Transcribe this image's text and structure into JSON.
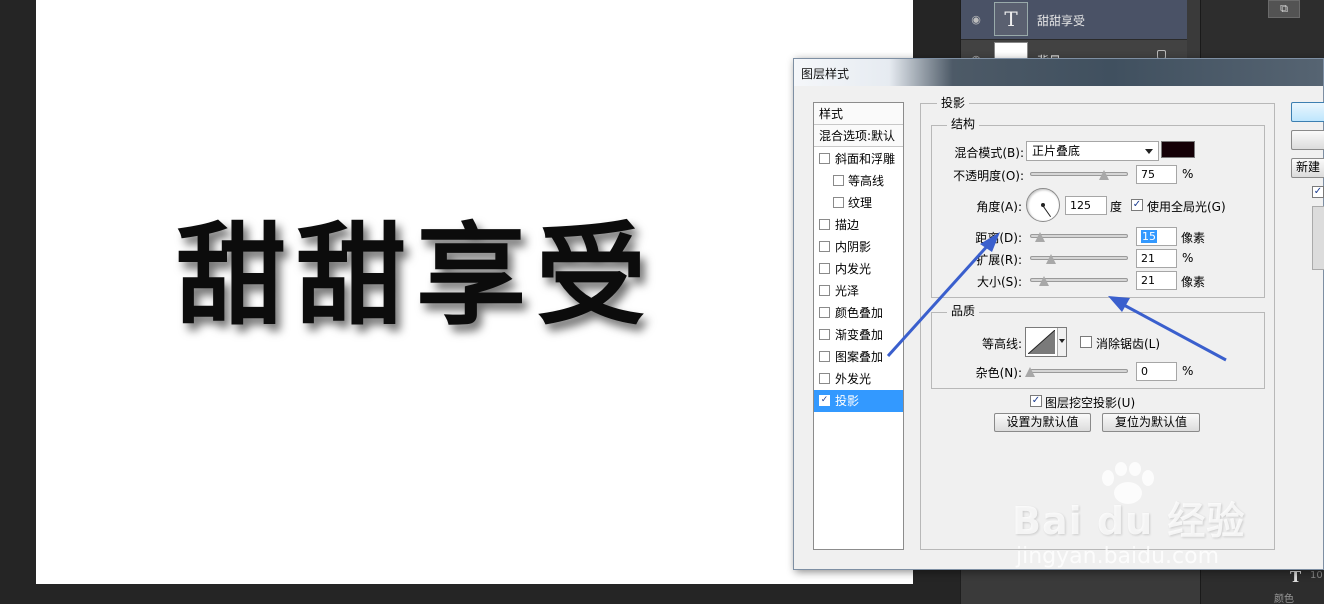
{
  "canvas": {
    "text": "甜甜享受"
  },
  "layers": {
    "text_layer": {
      "name": "甜甜享受",
      "thumb_glyph": "T"
    },
    "bg_layer": {
      "name": "背景"
    }
  },
  "right_panel": {
    "bottom_icon": "T",
    "bottom_num": "10",
    "bottom_label": "颜色"
  },
  "dialog": {
    "title": "图层样式",
    "style_list": {
      "header": "样式",
      "blend_options": "混合选项:默认",
      "items": [
        {
          "label": "斜面和浮雕",
          "checked": false,
          "indent": 0
        },
        {
          "label": "等高线",
          "checked": false,
          "indent": 1
        },
        {
          "label": "纹理",
          "checked": false,
          "indent": 1
        },
        {
          "label": "描边",
          "checked": false,
          "indent": 0
        },
        {
          "label": "内阴影",
          "checked": false,
          "indent": 0
        },
        {
          "label": "内发光",
          "checked": false,
          "indent": 0
        },
        {
          "label": "光泽",
          "checked": false,
          "indent": 0
        },
        {
          "label": "颜色叠加",
          "checked": false,
          "indent": 0
        },
        {
          "label": "渐变叠加",
          "checked": false,
          "indent": 0
        },
        {
          "label": "图案叠加",
          "checked": false,
          "indent": 0
        },
        {
          "label": "外发光",
          "checked": false,
          "indent": 0
        },
        {
          "label": "投影",
          "checked": true,
          "indent": 0,
          "selected": true
        }
      ]
    },
    "panel_title": "投影",
    "structure": {
      "title": "结构",
      "blend_mode_label": "混合模式(B):",
      "blend_mode_value": "正片叠底",
      "shadow_color": "#140006",
      "opacity_label": "不透明度(O):",
      "opacity_value": "75",
      "opacity_unit": "%",
      "angle_label": "角度(A):",
      "angle_value": "125",
      "angle_unit": "度",
      "global_light_label": "使用全局光(G)",
      "global_light_checked": true,
      "distance_label": "距离(D):",
      "distance_value": "15",
      "distance_unit": "像素",
      "spread_label": "扩展(R):",
      "spread_value": "21",
      "spread_unit": "%",
      "size_label": "大小(S):",
      "size_value": "21",
      "size_unit": "像素"
    },
    "quality": {
      "title": "品质",
      "contour_label": "等高线:",
      "antialias_label": "消除锯齿(L)",
      "antialias_checked": false,
      "noise_label": "杂色(N):",
      "noise_value": "0",
      "noise_unit": "%"
    },
    "knockout_label": "图层挖空投影(U)",
    "knockout_checked": true,
    "set_default_label": "设置为默认值",
    "reset_default_label": "复位为默认值",
    "side_buttons": {
      "new_style": "新建"
    }
  },
  "watermark": {
    "brand": "Bai du 经验",
    "url": "jingyan.baidu.com"
  },
  "colors": {
    "selection": "#3399ff",
    "arrow": "#3a5fcd",
    "workspace": "#252525"
  }
}
